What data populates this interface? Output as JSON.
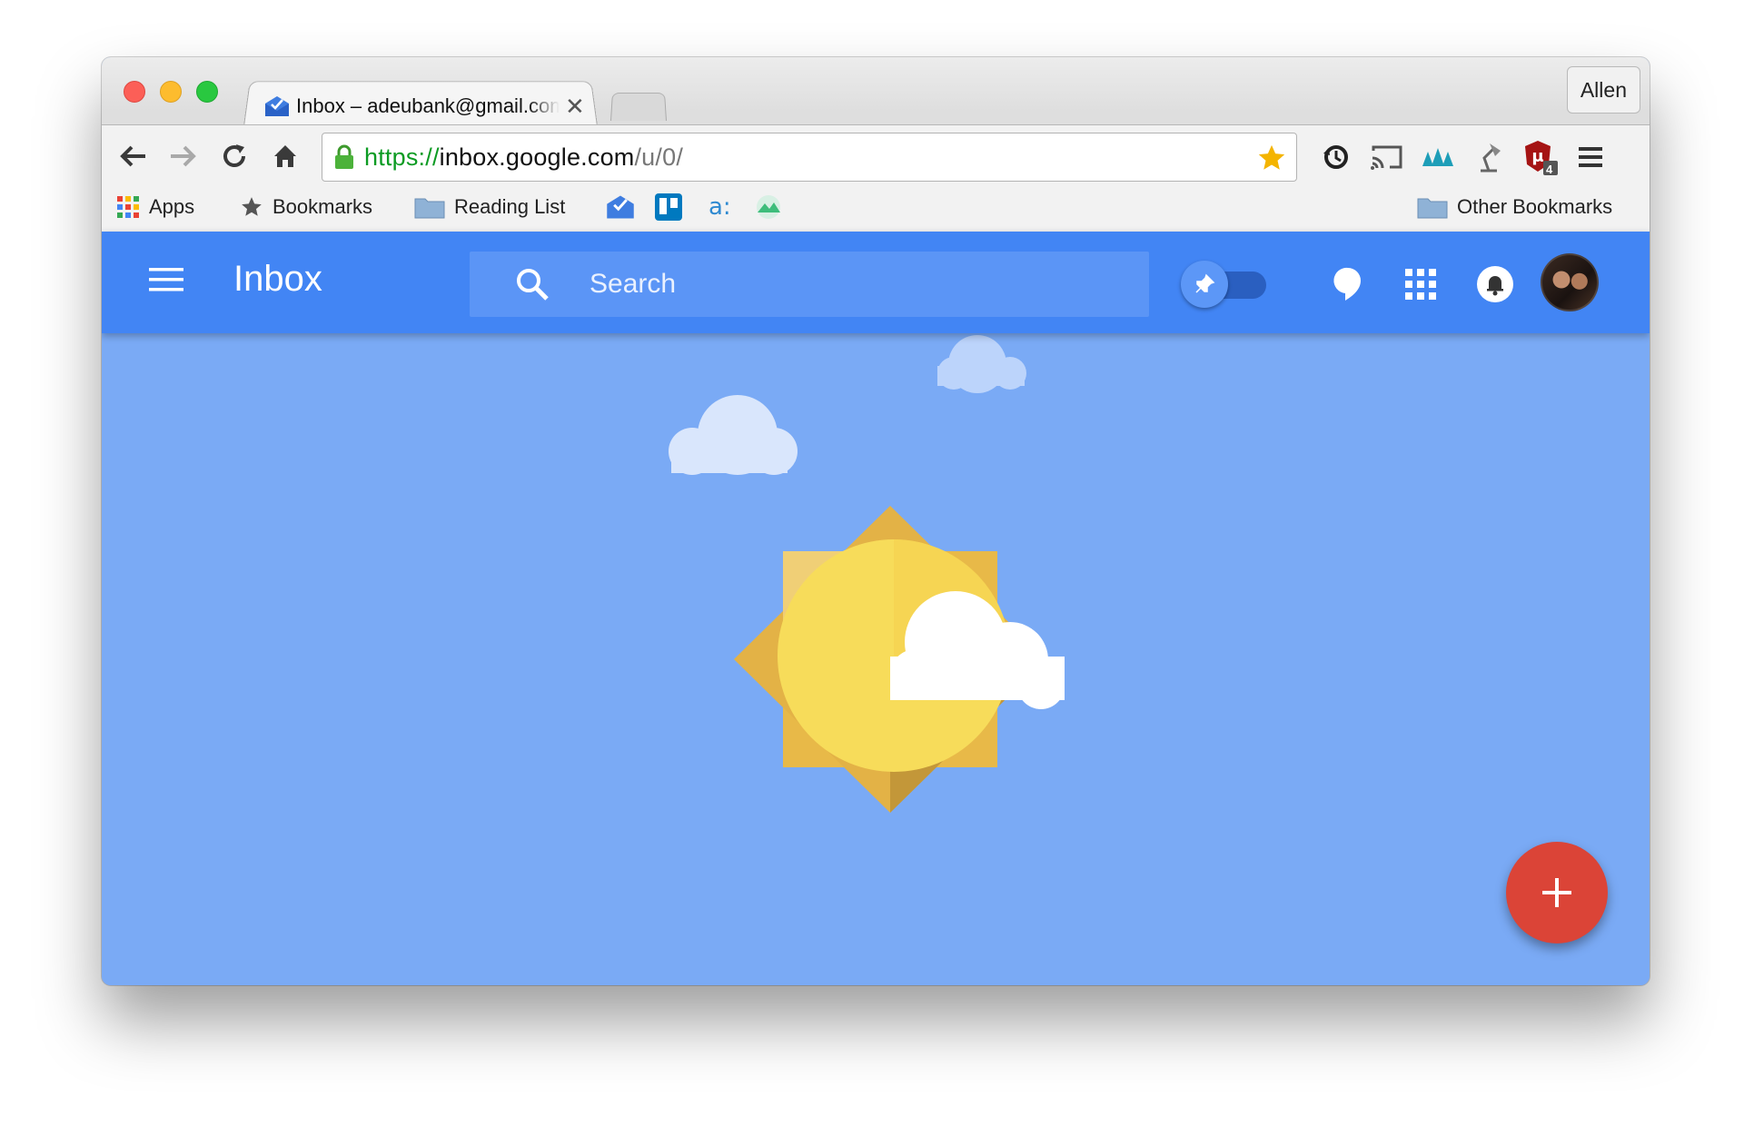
{
  "browser": {
    "tab": {
      "title": "Inbox – adeubank@gmail.com",
      "close_glyph": "✕",
      "favicon": "inbox-favicon-icon"
    },
    "profile_name": "Allen",
    "address_bar": {
      "scheme": "https://",
      "host": "inbox.google.com",
      "path": "/u/0/"
    },
    "nav_icons": [
      "back-icon",
      "forward-icon",
      "reload-icon",
      "home-icon"
    ],
    "extensions": [
      "sync-icon",
      "cast-icon",
      "meister-icon",
      "lamp-icon",
      "ublock-icon",
      "chrome-menu-icon"
    ],
    "ublock_badge": "4",
    "bookmarks": {
      "apps_label": "Apps",
      "bookmarks_label": "Bookmarks",
      "reading_list_label": "Reading List",
      "other_bookmarks_label": "Other Bookmarks",
      "favicon_items": [
        "inbox-bookmark-icon",
        "trello-bookmark-icon",
        "amazon-bookmark-icon",
        "mint-bookmark-icon"
      ]
    }
  },
  "inbox_app": {
    "title": "Inbox",
    "search_placeholder": "Search",
    "header_icons": [
      "menu-icon",
      "search-icon",
      "pin-toggle",
      "hangouts-icon",
      "apps-grid-icon",
      "notifications-icon",
      "avatar"
    ],
    "fab_label": "+",
    "colors": {
      "appbar": "#4285f4",
      "background": "#7aaaf5",
      "fab": "#db4437",
      "sun": "#f7dc5a"
    }
  }
}
